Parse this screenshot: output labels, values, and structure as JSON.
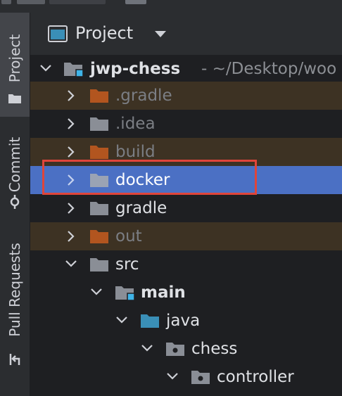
{
  "sidebar": {
    "tabs": [
      {
        "label": "Project",
        "icon": "folder-icon",
        "active": true
      },
      {
        "label": "Commit",
        "icon": "commit-icon",
        "active": false
      },
      {
        "label": "Pull Requests",
        "icon": "pull-request-icon",
        "active": false
      }
    ]
  },
  "header": {
    "title": "Project",
    "icon": "project-window-icon",
    "dropdown_icon": "caret-down-icon"
  },
  "tree": {
    "rows": [
      {
        "label": "jwp-chess",
        "suffix": "- ~/Desktop/woo",
        "state": "expanded",
        "icon": "module-folder-icon",
        "style": "root"
      },
      {
        "label": ".gradle",
        "state": "collapsed",
        "icon": "excluded-folder-icon",
        "style": "excluded"
      },
      {
        "label": ".idea",
        "state": "collapsed",
        "icon": "folder-icon",
        "style": "dim"
      },
      {
        "label": "build",
        "state": "collapsed",
        "icon": "excluded-folder-icon",
        "style": "excluded"
      },
      {
        "label": "docker",
        "state": "collapsed",
        "icon": "folder-icon",
        "style": "selected"
      },
      {
        "label": "gradle",
        "state": "collapsed",
        "icon": "folder-icon",
        "style": "normal"
      },
      {
        "label": "out",
        "state": "collapsed",
        "icon": "excluded-folder-icon",
        "style": "excluded"
      },
      {
        "label": "src",
        "state": "expanded",
        "icon": "folder-icon",
        "style": "normal"
      },
      {
        "label": "main",
        "state": "expanded",
        "icon": "module-folder-icon",
        "style": "bold"
      },
      {
        "label": "java",
        "state": "expanded",
        "icon": "source-root-icon",
        "style": "normal"
      },
      {
        "label": "chess",
        "state": "expanded",
        "icon": "package-icon",
        "style": "normal"
      },
      {
        "label": "controller",
        "state": "expanded",
        "icon": "package-icon",
        "style": "normal"
      }
    ]
  },
  "colors": {
    "selection": "#4b70c4",
    "highlight_box": "#e0453a",
    "excluded_row": "#3d3223",
    "excluded_folder": "#b2551f",
    "folder": "#8a8e96",
    "source_root": "#3a8fb7",
    "module_badge": "#3fb4e8"
  }
}
